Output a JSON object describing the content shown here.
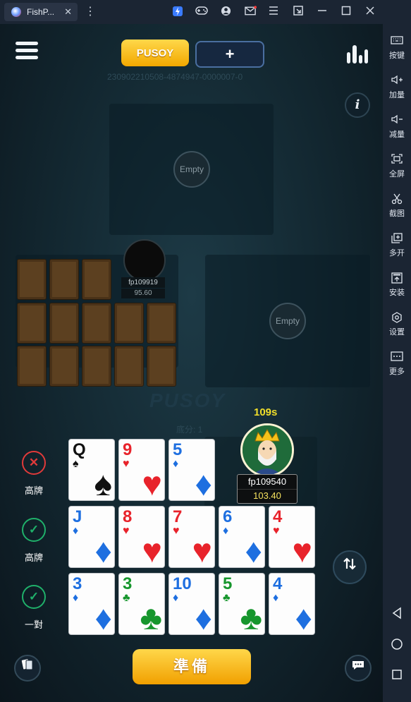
{
  "window": {
    "tab_title": "FishP...",
    "close_glyph": "✕",
    "more_glyph": "⋮",
    "title_icons": [
      "bolt-icon",
      "gamepad-icon",
      "user-icon",
      "mail-icon",
      "menu-icon",
      "resize-icon",
      "minimize-icon",
      "maximize-icon",
      "close-icon"
    ]
  },
  "sidebar": {
    "items": [
      {
        "label": "按键",
        "icon": "keyboard-icon"
      },
      {
        "label": "加量",
        "icon": "volume-up-icon"
      },
      {
        "label": "减量",
        "icon": "volume-down-icon"
      },
      {
        "label": "全屏",
        "icon": "fullscreen-icon"
      },
      {
        "label": "截图",
        "icon": "scissors-icon"
      },
      {
        "label": "多开",
        "icon": "multi-instance-icon"
      },
      {
        "label": "安装",
        "icon": "apk-install-icon"
      },
      {
        "label": "设置",
        "icon": "settings-icon"
      },
      {
        "label": "更多",
        "icon": "more-icon"
      }
    ],
    "nav": [
      "back-icon",
      "home-icon",
      "recents-icon"
    ]
  },
  "game": {
    "tab_pusoy": "PUSOY",
    "tab_add": "+",
    "table_id": "230902210508-4874947-0000007-0",
    "info_glyph": "i",
    "seat_top_empty": "Empty",
    "seat_right_empty": "Empty",
    "opponent": {
      "name": "fp109919",
      "coins": "95.60"
    },
    "watermark": "PUSOY",
    "base_score": "底分: 1",
    "timer": "109s",
    "player": {
      "name": "fp109540",
      "coins": "103.40"
    },
    "rows": [
      {
        "status": "高牌",
        "state": "invalid",
        "cards": [
          {
            "rank": "Q",
            "suit": "♠",
            "color": "black"
          },
          {
            "rank": "9",
            "suit": "♥",
            "color": "red"
          },
          {
            "rank": "5",
            "suit": "♦",
            "color": "blue"
          }
        ]
      },
      {
        "status": "高牌",
        "state": "valid",
        "cards": [
          {
            "rank": "J",
            "suit": "♦",
            "color": "blue"
          },
          {
            "rank": "8",
            "suit": "♥",
            "color": "red"
          },
          {
            "rank": "7",
            "suit": "♥",
            "color": "red"
          },
          {
            "rank": "6",
            "suit": "♦",
            "color": "blue"
          },
          {
            "rank": "4",
            "suit": "♥",
            "color": "red"
          }
        ]
      },
      {
        "status": "一對",
        "state": "valid",
        "cards": [
          {
            "rank": "3",
            "suit": "♦",
            "color": "blue"
          },
          {
            "rank": "3",
            "suit": "♣",
            "color": "green"
          },
          {
            "rank": "10",
            "suit": "♦",
            "color": "blue"
          },
          {
            "rank": "5",
            "suit": "♣",
            "color": "green"
          },
          {
            "rank": "4",
            "suit": "♦",
            "color": "blue"
          }
        ]
      }
    ],
    "ready_label": "準備",
    "colors": {
      "accent_gold": "#f2a800",
      "valid_green": "#1fb06a",
      "invalid_red": "#e03a3a"
    }
  }
}
